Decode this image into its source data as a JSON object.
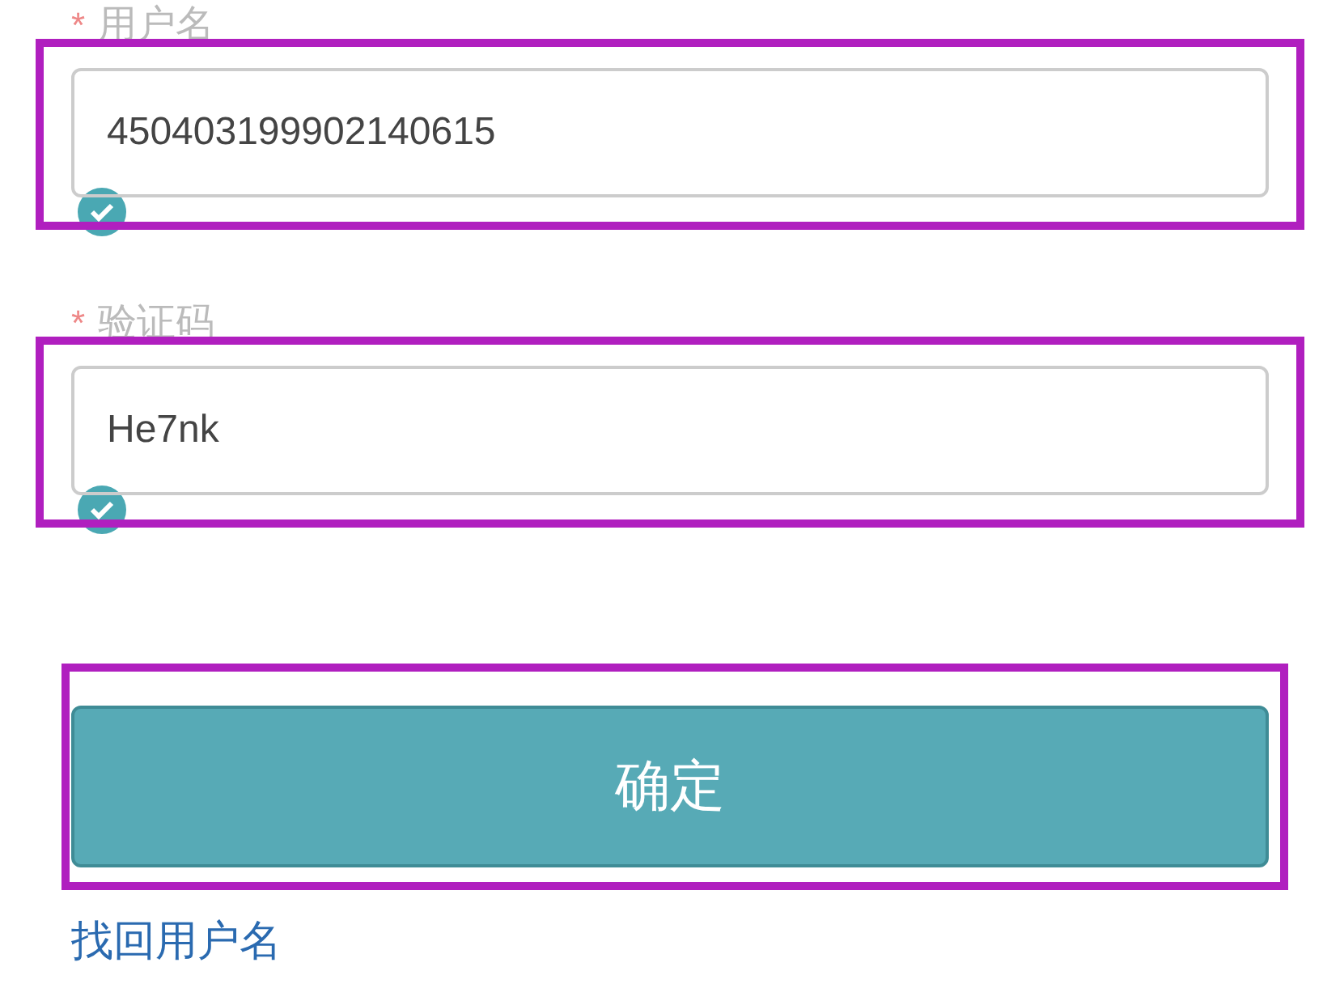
{
  "fields": [
    {
      "label": "用户名",
      "required_mark": "*",
      "value": "450403199902140615",
      "valid": true,
      "highlighted": true
    },
    {
      "label": "验证码",
      "required_mark": "*",
      "value": "He7nk",
      "valid": true,
      "highlighted": true
    }
  ],
  "submit_button": {
    "label": "确定",
    "highlighted": true
  },
  "link": "找回用户名"
}
